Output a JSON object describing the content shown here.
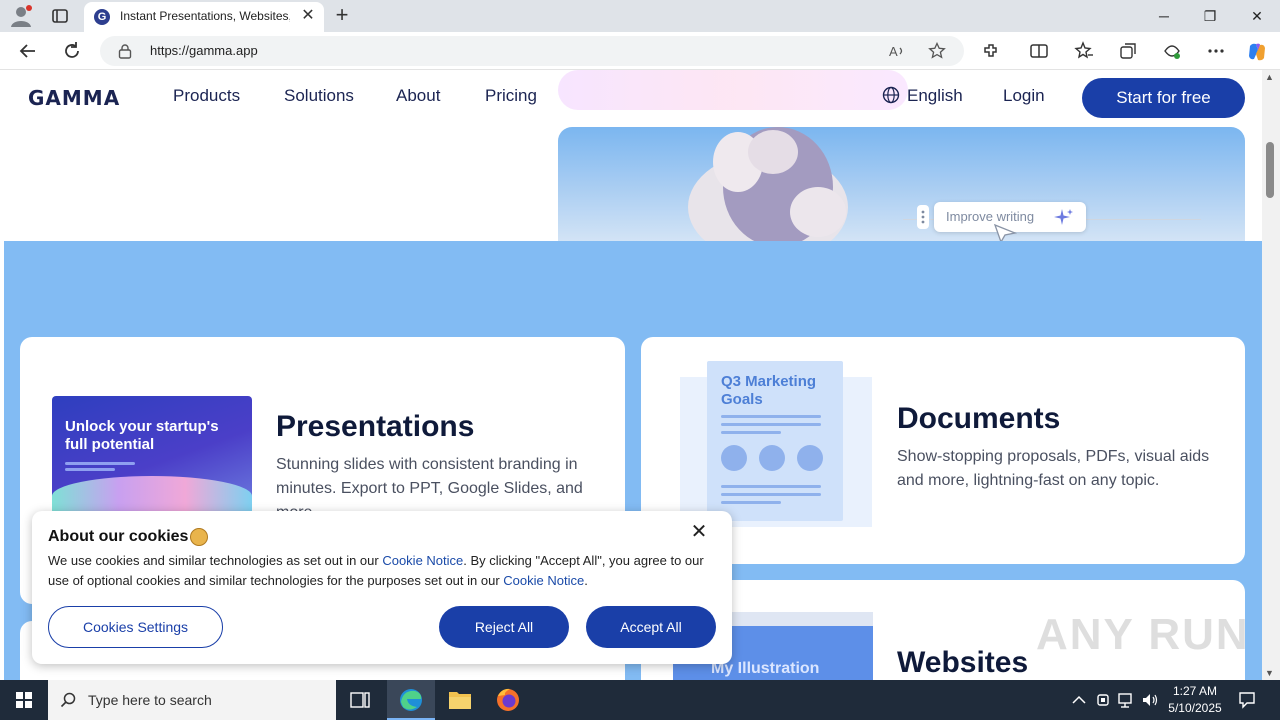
{
  "browser": {
    "tab_title": "Instant Presentations, Websites, &",
    "tab_favicon_letter": "G",
    "url": "https://gamma.app",
    "new_tab": "+",
    "controls": {
      "minimize": "─",
      "restore": "❐",
      "close": "✕"
    }
  },
  "site": {
    "logo": "GAMMA",
    "nav": [
      "Products",
      "Solutions",
      "About",
      "Pricing"
    ],
    "language": "English",
    "login": "Login",
    "cta": "Start for free",
    "hero_chip": "Improve writing"
  },
  "cards": {
    "presentations": {
      "title": "Presentations",
      "desc": "Stunning slides with consistent branding in minutes. Export to PPT, Google Slides, and more.",
      "thumb_title": "Unlock your startup's full potential"
    },
    "documents": {
      "title": "Documents",
      "desc": "Show-stopping proposals, PDFs, visual aids and more, lightning-fast on any topic.",
      "thumb_title": "Q3 Marketing Goals"
    },
    "websites": {
      "title": "Websites",
      "thumb_title": "My Illustration"
    }
  },
  "cookie": {
    "title": "About our cookies",
    "text_1": "We use cookies and similar technologies as set out in our ",
    "link_1": "Cookie Notice",
    "text_2": ". By clicking \"Accept All\", you agree to our use of optional cookies and similar technologies for the purposes set out in our ",
    "link_2": "Cookie Notice",
    "text_3": ".",
    "settings": "Cookies Settings",
    "reject": "Reject All",
    "accept": "Accept All",
    "close": "✕"
  },
  "watermark": "ANY RUN",
  "taskbar": {
    "search_placeholder": "Type here to search",
    "time": "1:27 AM",
    "date": "5/10/2025"
  },
  "colors": {
    "brand_blue": "#1a3fa8",
    "section_bg": "#82bbf3",
    "heading": "#0f1a3a"
  }
}
